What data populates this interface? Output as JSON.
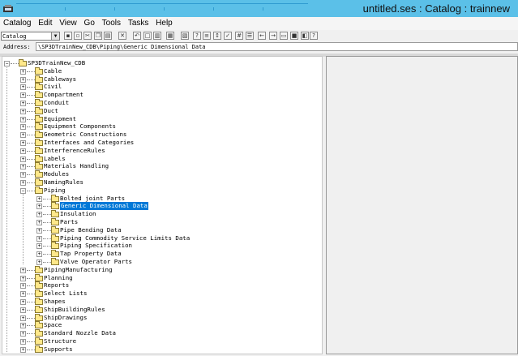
{
  "window": {
    "title": "untitled.ses : Catalog : trainnew"
  },
  "menu": [
    "Catalog",
    "Edit",
    "View",
    "Go",
    "Tools",
    "Tasks",
    "Help"
  ],
  "toolbar": {
    "combo_value": "Catalog",
    "buttons": [
      "save-icon",
      "print-icon",
      "cut-icon",
      "copy-icon",
      "paste-icon",
      "delete-icon",
      "undo-icon",
      "new-icon",
      "insert-icon",
      "properties-icon",
      "report-icon",
      "query-icon",
      "filter-icon",
      "sort-icon",
      "check-icon",
      "grid-icon",
      "list-icon",
      "back-icon",
      "forward-icon",
      "folder-icon",
      "stop-icon",
      "view-icon",
      "help-icon"
    ]
  },
  "address": {
    "label": "Address:",
    "value": "\\SP3DTrainNew_CDB\\Piping\\Generic Dimensional Data"
  },
  "tree": {
    "root": "SP3DTrainNew_CDB",
    "items": [
      "Cable",
      "Cableways",
      "Civil",
      "Compartment",
      "Conduit",
      "Duct",
      "Equipment",
      "Equipment Components",
      "Geometric Constructions",
      "Interfaces and Categories",
      "InterferenceRules",
      "Labels",
      "Materials Handling",
      "Modules",
      "NamingRules",
      "Piping"
    ],
    "piping_children": [
      "Bolted joint Parts",
      "Generic Dimensional Data",
      "Insulation",
      "Parts",
      "Pipe Bending Data",
      "Piping Commodity Service Limits Data",
      "Piping Specification",
      "Tap Property Data",
      "Valve Operator Parts"
    ],
    "items_after": [
      "PipingManufacturing",
      "Planning",
      "Reports",
      "Select Lists",
      "Shapes",
      "ShipBuildingRules",
      "ShipDrawings",
      "Space",
      "Standard Nozzle Data",
      "Structure",
      "Supports"
    ],
    "selected": "Generic Dimensional Data"
  },
  "colors": {
    "titlebar": "#5bc0e8",
    "selection": "#0078d7",
    "folder": "#ffe88a"
  }
}
